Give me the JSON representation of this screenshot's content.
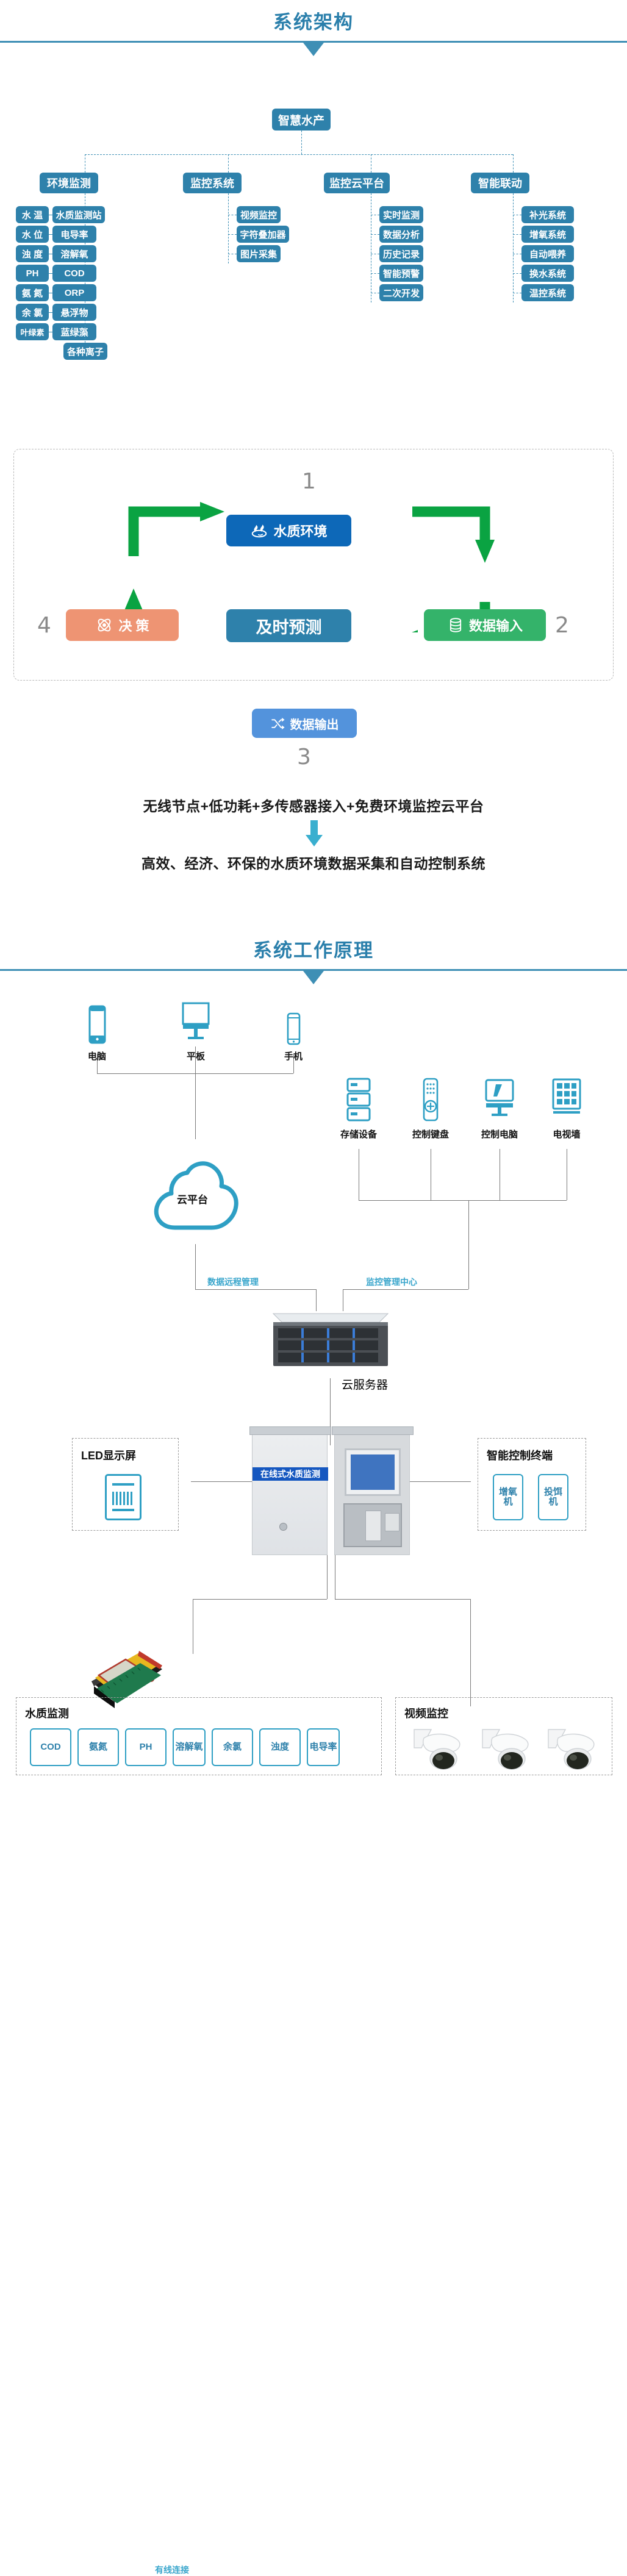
{
  "sections": {
    "architecture_title": "系统架构",
    "principle_title": "系统工作原理"
  },
  "architecture": {
    "root": "智慧水产",
    "columns": [
      {
        "category": "环境监测",
        "left_leaves": [
          "水 温",
          "水 位",
          "浊 度",
          "PH",
          "氨 氮",
          "余 氯",
          "叶绿素"
        ],
        "right_leaves": [
          "水质监测站",
          "电导率",
          "溶解氧",
          "COD",
          "ORP",
          "悬浮物",
          "蓝绿藻"
        ],
        "bottom_leaf": "各种离子"
      },
      {
        "category": "监控系统",
        "right_leaves": [
          "视频监控",
          "字符叠加器",
          "图片采集"
        ]
      },
      {
        "category": "监控云平台",
        "right_leaves": [
          "实时监测",
          "数据分析",
          "历史记录",
          "智能预警",
          "二次开发"
        ]
      },
      {
        "category": "智能联动",
        "right_leaves": [
          "补光系统",
          "增氧系统",
          "自动喂养",
          "换水系统",
          "温控系统"
        ]
      }
    ]
  },
  "cycle": {
    "nodes": [
      {
        "label": "水质环境",
        "number": "1",
        "icon": "water-quality-icon",
        "color": "#0d68b8"
      },
      {
        "label": "数据输入",
        "number": "2",
        "icon": "database-icon",
        "color": "#34b36a"
      },
      {
        "label": "数据输出",
        "number": "3",
        "icon": "shuffle-icon",
        "color": "#5393dc"
      },
      {
        "label": "决 策",
        "number": "4",
        "icon": "atom-icon",
        "color": "#ee9473"
      }
    ],
    "center": {
      "label": "及时预测",
      "color": "#2e81ab"
    },
    "arrow_color": "#0aa342",
    "taglines": [
      "无线节点+低功耗+多传感器接入+免费环境监控云平台",
      "高效、经济、环保的水质环境数据采集和自动控制系统"
    ],
    "down_arrow_color": "#3aafcf"
  },
  "principle": {
    "top_devices": [
      {
        "label": "电脑",
        "icon": "tablet-icon"
      },
      {
        "label": "平板",
        "icon": "desktop-monitor-icon"
      },
      {
        "label": "手机",
        "icon": "smartphone-icon"
      }
    ],
    "ops_devices": [
      {
        "label": "存储设备",
        "icon": "storage-rack-icon"
      },
      {
        "label": "控制键盘",
        "icon": "control-keypad-icon"
      },
      {
        "label": "控制电脑",
        "icon": "control-computer-icon"
      },
      {
        "label": "电视墙",
        "icon": "video-wall-icon"
      }
    ],
    "cloud": {
      "label": "云平台",
      "icon": "cloud-icon"
    },
    "edge_labels": {
      "remote": "数据远程管理",
      "center": "监控管理中心",
      "wired": "有线连接"
    },
    "server": {
      "label": "云服务器",
      "icon": "rack-server-icon"
    },
    "cabinet_banner": "在线式水质监测",
    "led_panel": {
      "title": "LED显示屏",
      "chip": "LED",
      "icon": "led-display-icon"
    },
    "control_panel": {
      "title": "智能控制终端",
      "chips": [
        "增氧机",
        "投饵机"
      ]
    },
    "water_panel": {
      "title": "水质监测",
      "chips": [
        "COD",
        "氨氮",
        "PH",
        "溶解氧",
        "余氯",
        "浊度",
        "电导率"
      ]
    },
    "video_panel": {
      "title": "视频监控",
      "camera_count": 3,
      "icon": "ptz-camera-icon"
    }
  },
  "colors": {
    "brand_blue": "#2e81ab",
    "title_blue": "#2a7fab",
    "accent_cyan": "#3aa6cc",
    "green": "#0aa342",
    "orange": "#ee9473"
  }
}
